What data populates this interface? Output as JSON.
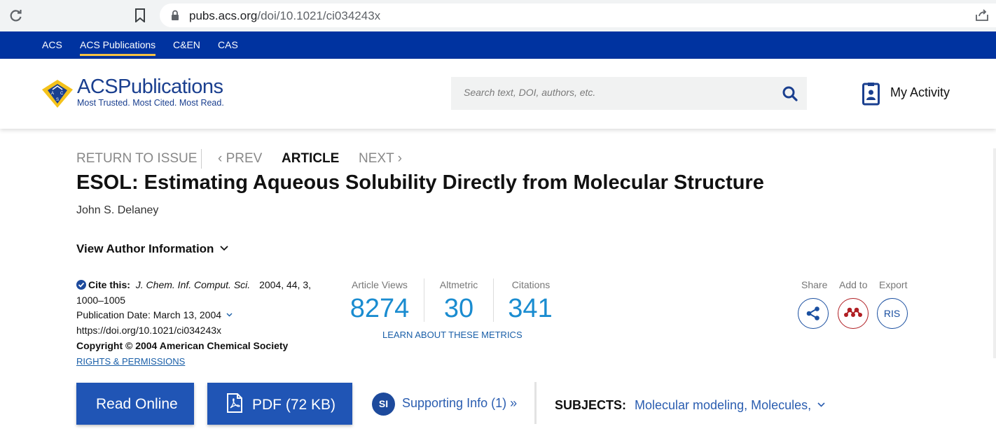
{
  "browser": {
    "url_host": "pubs.acs.org",
    "url_path": "/doi/10.1021/ci034243x",
    "icons": [
      "reload-icon",
      "bookmark-icon",
      "lock-icon",
      "share-page-icon"
    ]
  },
  "acs_nav": {
    "items": [
      {
        "label": "ACS"
      },
      {
        "label": "ACS Publications",
        "active": true
      },
      {
        "label": "C&EN"
      },
      {
        "label": "CAS"
      }
    ],
    "bg_color": "#0033a0",
    "active_underline": "#f6c243"
  },
  "header": {
    "logo_text_1": "ACS",
    "logo_text_2": "Publications",
    "logo_tagline": "Most Trusted. Most Cited. Most Read.",
    "logo_emblem_text": [
      "A",
      "C",
      "S"
    ],
    "search_placeholder": "Search text, DOI, authors, etc.",
    "my_activity": "My Activity"
  },
  "article_nav": {
    "return": "RETURN TO ISSUE",
    "prev": "PREV",
    "current": "ARTICLE",
    "next": "NEXT"
  },
  "article": {
    "title": "ESOL:  Estimating Aqueous Solubility Directly from Molecular Structure",
    "authors": "John S. Delaney",
    "author_info": "View Author Information"
  },
  "cite": {
    "label": "Cite this:",
    "journal": "J. Chem. Inf. Comput. Sci.",
    "details": "2004, 44, 3,",
    "pages": "1000–1005",
    "pub_date": "Publication Date: March 13, 2004",
    "doi": "https://doi.org/10.1021/ci034243x",
    "copyright": "Copyright © 2004 American Chemical Society",
    "rights": "RIGHTS & PERMISSIONS"
  },
  "metrics": {
    "items": [
      {
        "label": "Article Views",
        "value": "8274"
      },
      {
        "label": "Altmetric",
        "value": "30"
      },
      {
        "label": "Citations",
        "value": "341"
      }
    ],
    "learn": "LEARN ABOUT THESE METRICS",
    "value_color": "#1a8cd0"
  },
  "tools": {
    "share": "Share",
    "add_to": "Add to",
    "export": "Export",
    "export_format": "RIS"
  },
  "actions": {
    "read_online": "Read Online",
    "pdf": "PDF (72 KB)",
    "si_badge": "SI",
    "supporting_info": "Supporting Info (1) »",
    "subjects_label": "SUBJECTS:",
    "subjects": "Molecular modeling, Molecules,",
    "button_color": "#2055b5"
  }
}
